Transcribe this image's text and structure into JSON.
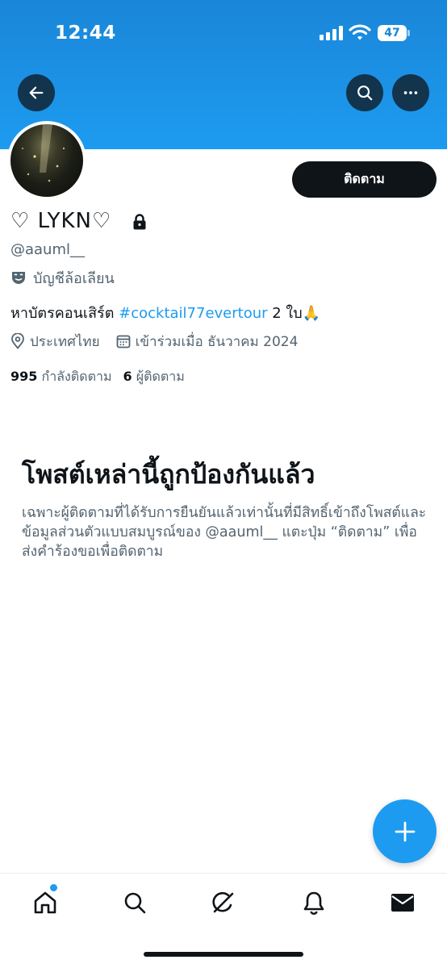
{
  "status_bar": {
    "time": "12:44",
    "battery": "47"
  },
  "profile": {
    "display_name": "♡ LYKN♡",
    "handle": "@aauml__",
    "parody_label": "บัญชีล้อเลียน",
    "bio_prefix": "หาบัตรคอนเสิร์ต ",
    "bio_hashtag": "#cocktail77evertour",
    "bio_suffix": " 2 ใบ🙏",
    "location": "ประเทศไทย",
    "joined": "เข้าร่วมเมื่อ ธันวาคม 2024",
    "following_count": "995",
    "following_label": "กำลังติดตาม",
    "followers_count": "6",
    "followers_label": "ผู้ติดตาม",
    "follow_button": "ติดตาม"
  },
  "protected": {
    "title": "โพสต์เหล่านี้ถูกป้องกันแล้ว",
    "body": "เฉพาะผู้ติดตามที่ได้รับการยืนยันแล้วเท่านั้นที่มีสิทธิ์เข้าถึงโพสต์และข้อมูลส่วนตัวแบบสมบูรณ์ของ @aauml__ แตะปุ่ม “ติดตาม” เพื่อส่งคำร้องขอเพื่อติดตาม"
  },
  "colors": {
    "accent": "#1d9bf0",
    "text": "#0f1419",
    "secondary": "#536471"
  },
  "icons": {
    "back": "arrow-left-icon",
    "search": "search-icon",
    "more": "more-icon",
    "lock": "lock-icon",
    "parody": "theater-mask-icon",
    "location": "location-pin-icon",
    "calendar": "calendar-icon",
    "compose": "plus-icon",
    "nav": [
      "home-icon",
      "search-icon",
      "grok-icon",
      "bell-icon",
      "mail-icon"
    ]
  }
}
